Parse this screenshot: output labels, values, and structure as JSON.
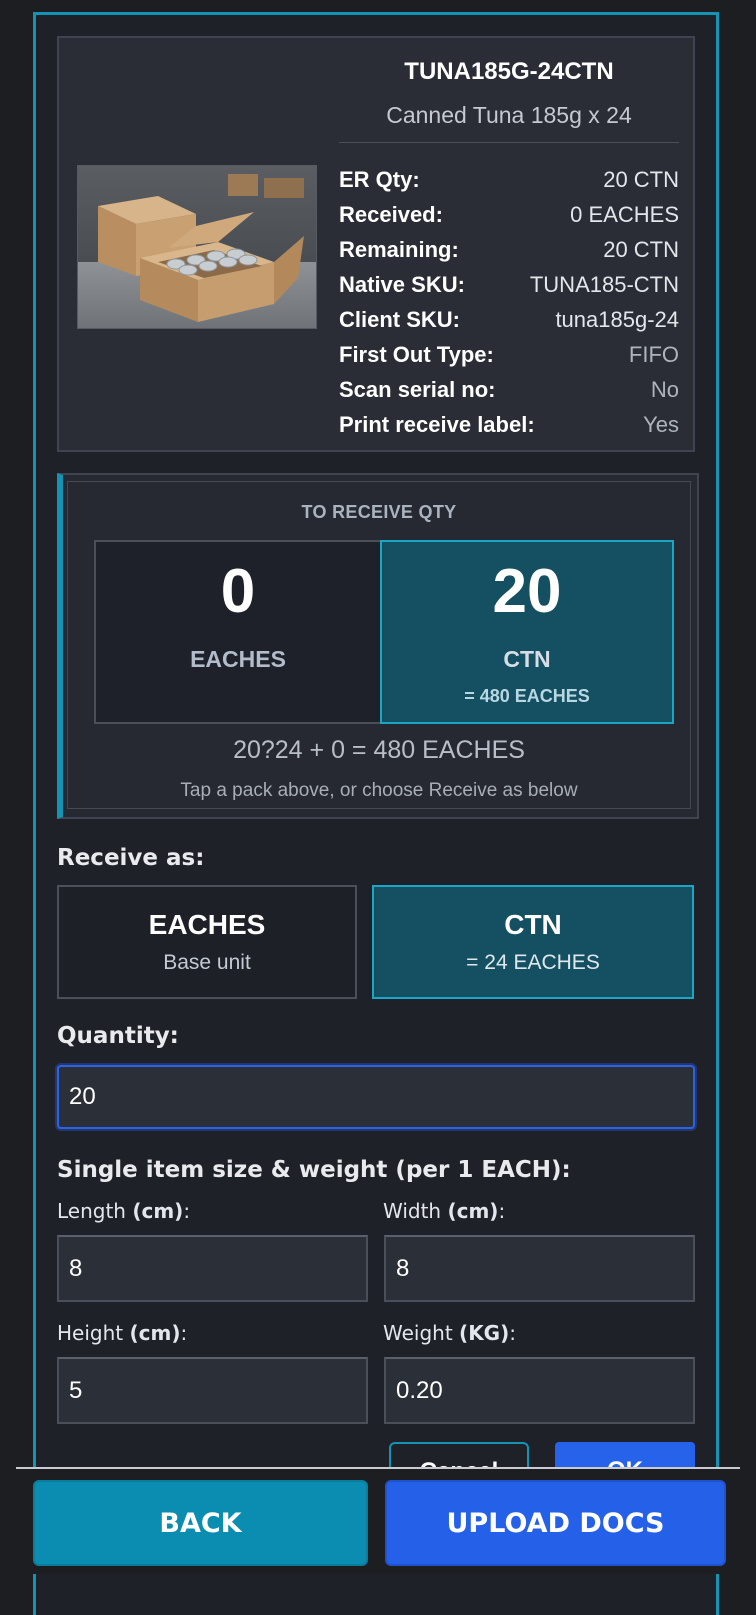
{
  "item": {
    "sku": "TUNA185G-24CTN",
    "description": "Canned Tuna 185g x 24",
    "details": [
      {
        "label": "ER Qty:",
        "value": "20 CTN"
      },
      {
        "label": "Received:",
        "value": "0 EACHES"
      },
      {
        "label": "Remaining:",
        "value": "20 CTN"
      },
      {
        "label": "Native SKU:",
        "value": "TUNA185-CTN"
      },
      {
        "label": "Client SKU:",
        "value": "tuna185g-24"
      },
      {
        "label": "First Out Type:",
        "value": "FIFO"
      },
      {
        "label": "Scan serial no:",
        "value": "No"
      },
      {
        "label": "Print receive label:",
        "value": "Yes"
      }
    ]
  },
  "to_receive": {
    "title": "TO RECEIVE QTY",
    "eaches_value": "0",
    "eaches_unit": "EACHES",
    "ctn_value": "20",
    "ctn_unit": "CTN",
    "ctn_conversion": "= 480 EACHES",
    "formula": "20?24 + 0 = 480 EACHES",
    "hint": "Tap a pack above, or choose Receive as below"
  },
  "receive_as": {
    "label": "Receive as:",
    "options": [
      {
        "title": "EACHES",
        "subtitle": "Base unit"
      },
      {
        "title": "CTN",
        "subtitle": "= 24 EACHES"
      }
    ],
    "selected": "CTN"
  },
  "quantity": {
    "label": "Quantity:",
    "value": "20"
  },
  "dimensions": {
    "heading": "Single item size & weight (per 1 EACH):",
    "length": {
      "label": "Length ",
      "unit": "(cm)",
      "suffix": ":",
      "value": "8"
    },
    "width": {
      "label": "Width ",
      "unit": "(cm)",
      "suffix": ":",
      "value": "8"
    },
    "height": {
      "label": "Height ",
      "unit": "(cm)",
      "suffix": ":",
      "value": "5"
    },
    "weight": {
      "label": "Weight ",
      "unit": "(KG)",
      "suffix": ":",
      "value": "0.20"
    }
  },
  "dialog_buttons": {
    "cancel": "Cancel",
    "ok": "OK"
  },
  "footer": {
    "back": "BACK",
    "upload": "UPLOAD DOCS"
  },
  "colors": {
    "accent": "#1493b3",
    "selected_fill": "#145062",
    "primary": "#2763ea"
  }
}
